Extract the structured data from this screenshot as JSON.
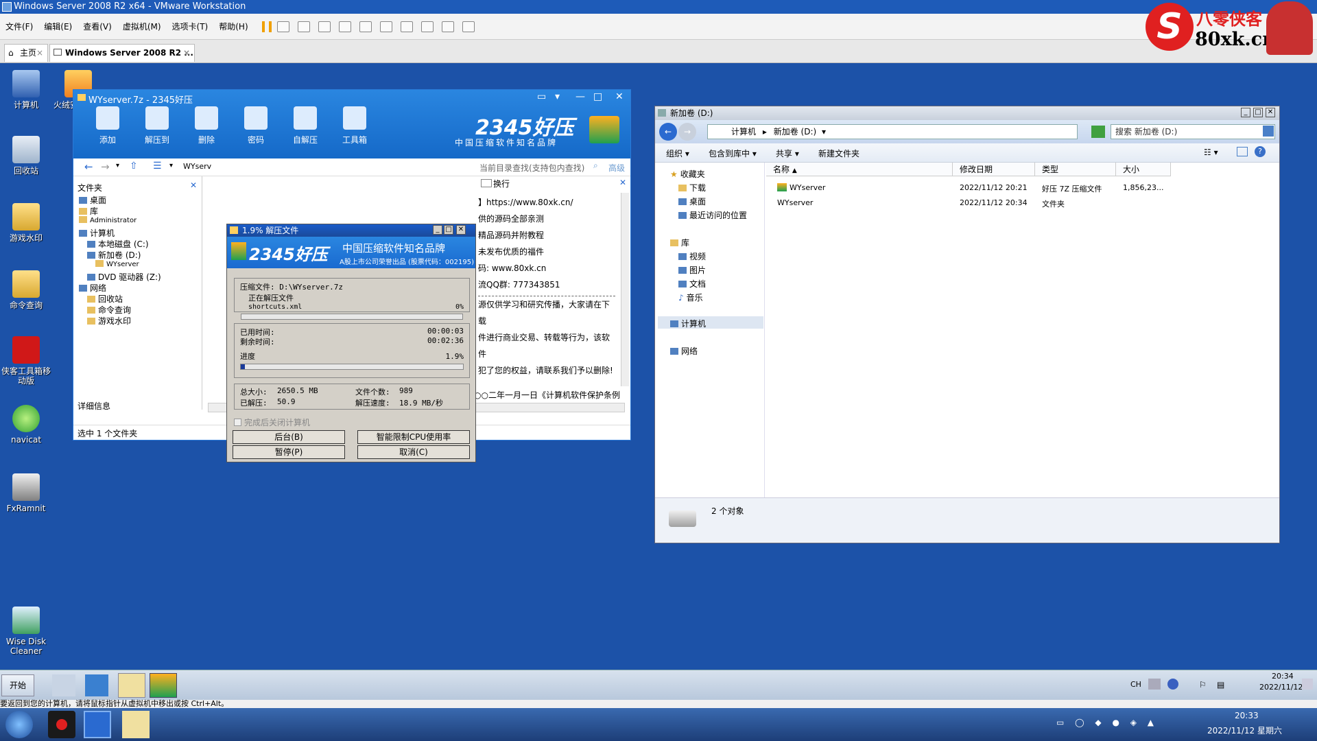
{
  "vm": {
    "title": "Windows Server 2008 R2 x64 - VMware Workstation",
    "menu": [
      "文件(F)",
      "编辑(E)",
      "查看(V)",
      "虚拟机(M)",
      "选项卡(T)",
      "帮助(H)"
    ],
    "tabs": [
      {
        "label": "主页"
      },
      {
        "label": "Windows Server 2008 R2 ..."
      }
    ],
    "status_hint": "要返回到您的计算机，请将鼠标指针从虚拟机中移出或按 Ctrl+Alt。"
  },
  "brand": {
    "line1": "八零侠客",
    "line2": "80xk.cn"
  },
  "desktop_icons": [
    {
      "label": "计算机"
    },
    {
      "label": "火绒安全软件"
    },
    {
      "label": "回收站"
    },
    {
      "label": "游戏水印"
    },
    {
      "label": "命令查询"
    },
    {
      "label": "侠客工具箱移动版"
    },
    {
      "label": "navicat"
    },
    {
      "label": "FxRamnit"
    },
    {
      "label": "Wise Disk Cleaner"
    }
  ],
  "hz": {
    "title": "WYserver.7z - 2345好压",
    "toolbar": [
      "添加",
      "解压到",
      "删除",
      "密码",
      "自解压",
      "工具箱"
    ],
    "brand": "2345好压",
    "brand_sub": "中国压缩软件知名品牌",
    "nav_path": "WYserv",
    "search_placeholder": "当前目录查找(支持包内查找)",
    "advanced": "高级",
    "wrap": "换行",
    "folder_pane_title": "文件夹",
    "tree": [
      "桌面",
      "库",
      "Administrator",
      "计算机",
      "本地磁盘 (C:)",
      "新加卷 (D:)",
      "WYserver",
      "DVD 驱动器 (Z:)",
      "网络",
      "回收站",
      "命令查询",
      "游戏水印"
    ],
    "details": "详细信息",
    "selection": "选中 1 个文件夹",
    "content_lines": [
      "】https://www.80xk.cn/",
      "供的源码全部亲测",
      "精品源码并附教程",
      "未发布优质的福件",
      "码: www.80xk.cn",
      "流QQ群: 777343851",
      "源仅供学习和研究传播，大家请在下载",
      "件进行商业交易、转载等行为，该软件",
      "犯了您的权益，请联系我们予以删除!",
      "根据二○○二年一月一日《计算机软件保护条例"
    ]
  },
  "extract": {
    "title": "1.9% 解压文件",
    "brand": "2345好压",
    "brand_sub": "中国压缩软件知名品牌",
    "brand_note": "A股上市公司荣誉出品 (股票代码：002195)",
    "archive_label": "压缩文件: D:\\WYserver.7z",
    "status": "正在解压文件",
    "current_file": "shortcuts.xml",
    "file_percent": "0%",
    "file_progress": 0,
    "elapsed_label": "已用时间:",
    "elapsed": "00:00:03",
    "remaining_label": "剩余时间:",
    "remaining": "00:02:36",
    "progress_label": "进度",
    "progress_text": "1.9%",
    "progress": 1.9,
    "total_size_label": "总大小:",
    "total_size": "2650.5 MB",
    "extracted_label": "已解压:",
    "extracted": "50.9",
    "file_count_label": "文件个数:",
    "file_count": "989",
    "speed_label": "解压速度:",
    "speed": "18.9 MB/秒",
    "shutdown": "完成后关闭计算机",
    "buttons": {
      "background": "后台(B)",
      "cpu_limit": "智能限制CPU使用率",
      "pause": "暂停(P)",
      "cancel": "取消(C)"
    }
  },
  "explorer": {
    "title": "新加卷 (D:)",
    "breadcrumb": [
      "计算机",
      "新加卷 (D:)"
    ],
    "search_placeholder": "搜索 新加卷 (D:)",
    "commands": [
      "组织",
      "包含到库中",
      "共享",
      "新建文件夹"
    ],
    "nav": {
      "favorites": "收藏夹",
      "fav_items": [
        "下载",
        "桌面",
        "最近访问的位置"
      ],
      "libraries": "库",
      "lib_items": [
        "视频",
        "图片",
        "文档",
        "音乐"
      ],
      "computer": "计算机",
      "network": "网络"
    },
    "columns": [
      "名称",
      "修改日期",
      "类型",
      "大小"
    ],
    "rows": [
      {
        "name": "WYserver",
        "date": "2022/11/12 20:21",
        "type": "好压 7Z 压缩文件",
        "size": "1,856,23..."
      },
      {
        "name": "WYserver",
        "date": "2022/11/12 20:34",
        "type": "文件夹",
        "size": ""
      }
    ],
    "count": "2 个对象"
  },
  "guest_taskbar": {
    "start": "开始",
    "lang": "CH",
    "time": "20:34",
    "date": "2022/11/12"
  },
  "host_taskbar": {
    "time": "20:33",
    "date": "2022/11/12 星期六"
  }
}
